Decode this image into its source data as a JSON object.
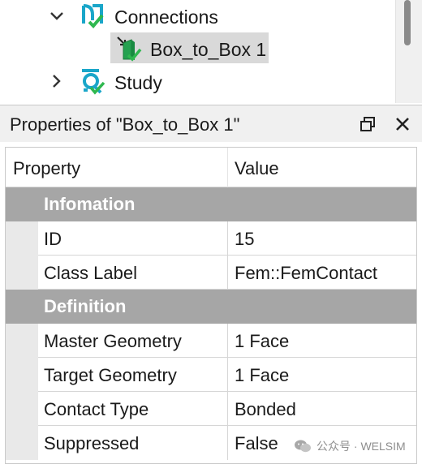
{
  "tree": {
    "items": [
      {
        "label": "Connections",
        "icon": "connections-icon",
        "expanded": true
      },
      {
        "label": "Box_to_Box 1",
        "icon": "contact-icon",
        "selected": true
      },
      {
        "label": "Study",
        "icon": "study-icon",
        "expanded": false
      }
    ]
  },
  "properties": {
    "title": "Properties of \"Box_to_Box 1\"",
    "columns": [
      "Property",
      "Value"
    ],
    "sections": [
      {
        "label": "Infomation",
        "rows": [
          {
            "name": "ID",
            "value": "15"
          },
          {
            "name": "Class Label",
            "value": "Fem::FemContact"
          }
        ]
      },
      {
        "label": "Definition",
        "rows": [
          {
            "name": "Master Geometry",
            "value": "1 Face"
          },
          {
            "name": "Target Geometry",
            "value": "1 Face"
          },
          {
            "name": "Contact Type",
            "value": "Bonded"
          },
          {
            "name": "Suppressed",
            "value": "False"
          }
        ]
      }
    ]
  },
  "watermark": {
    "text": "公众号 · WELSIM"
  },
  "colors": {
    "section_bg": "#a6a6a6",
    "selection_bg": "#d9d9d9",
    "icon_teal": "#1aa6c9",
    "icon_green": "#2fb84f"
  }
}
